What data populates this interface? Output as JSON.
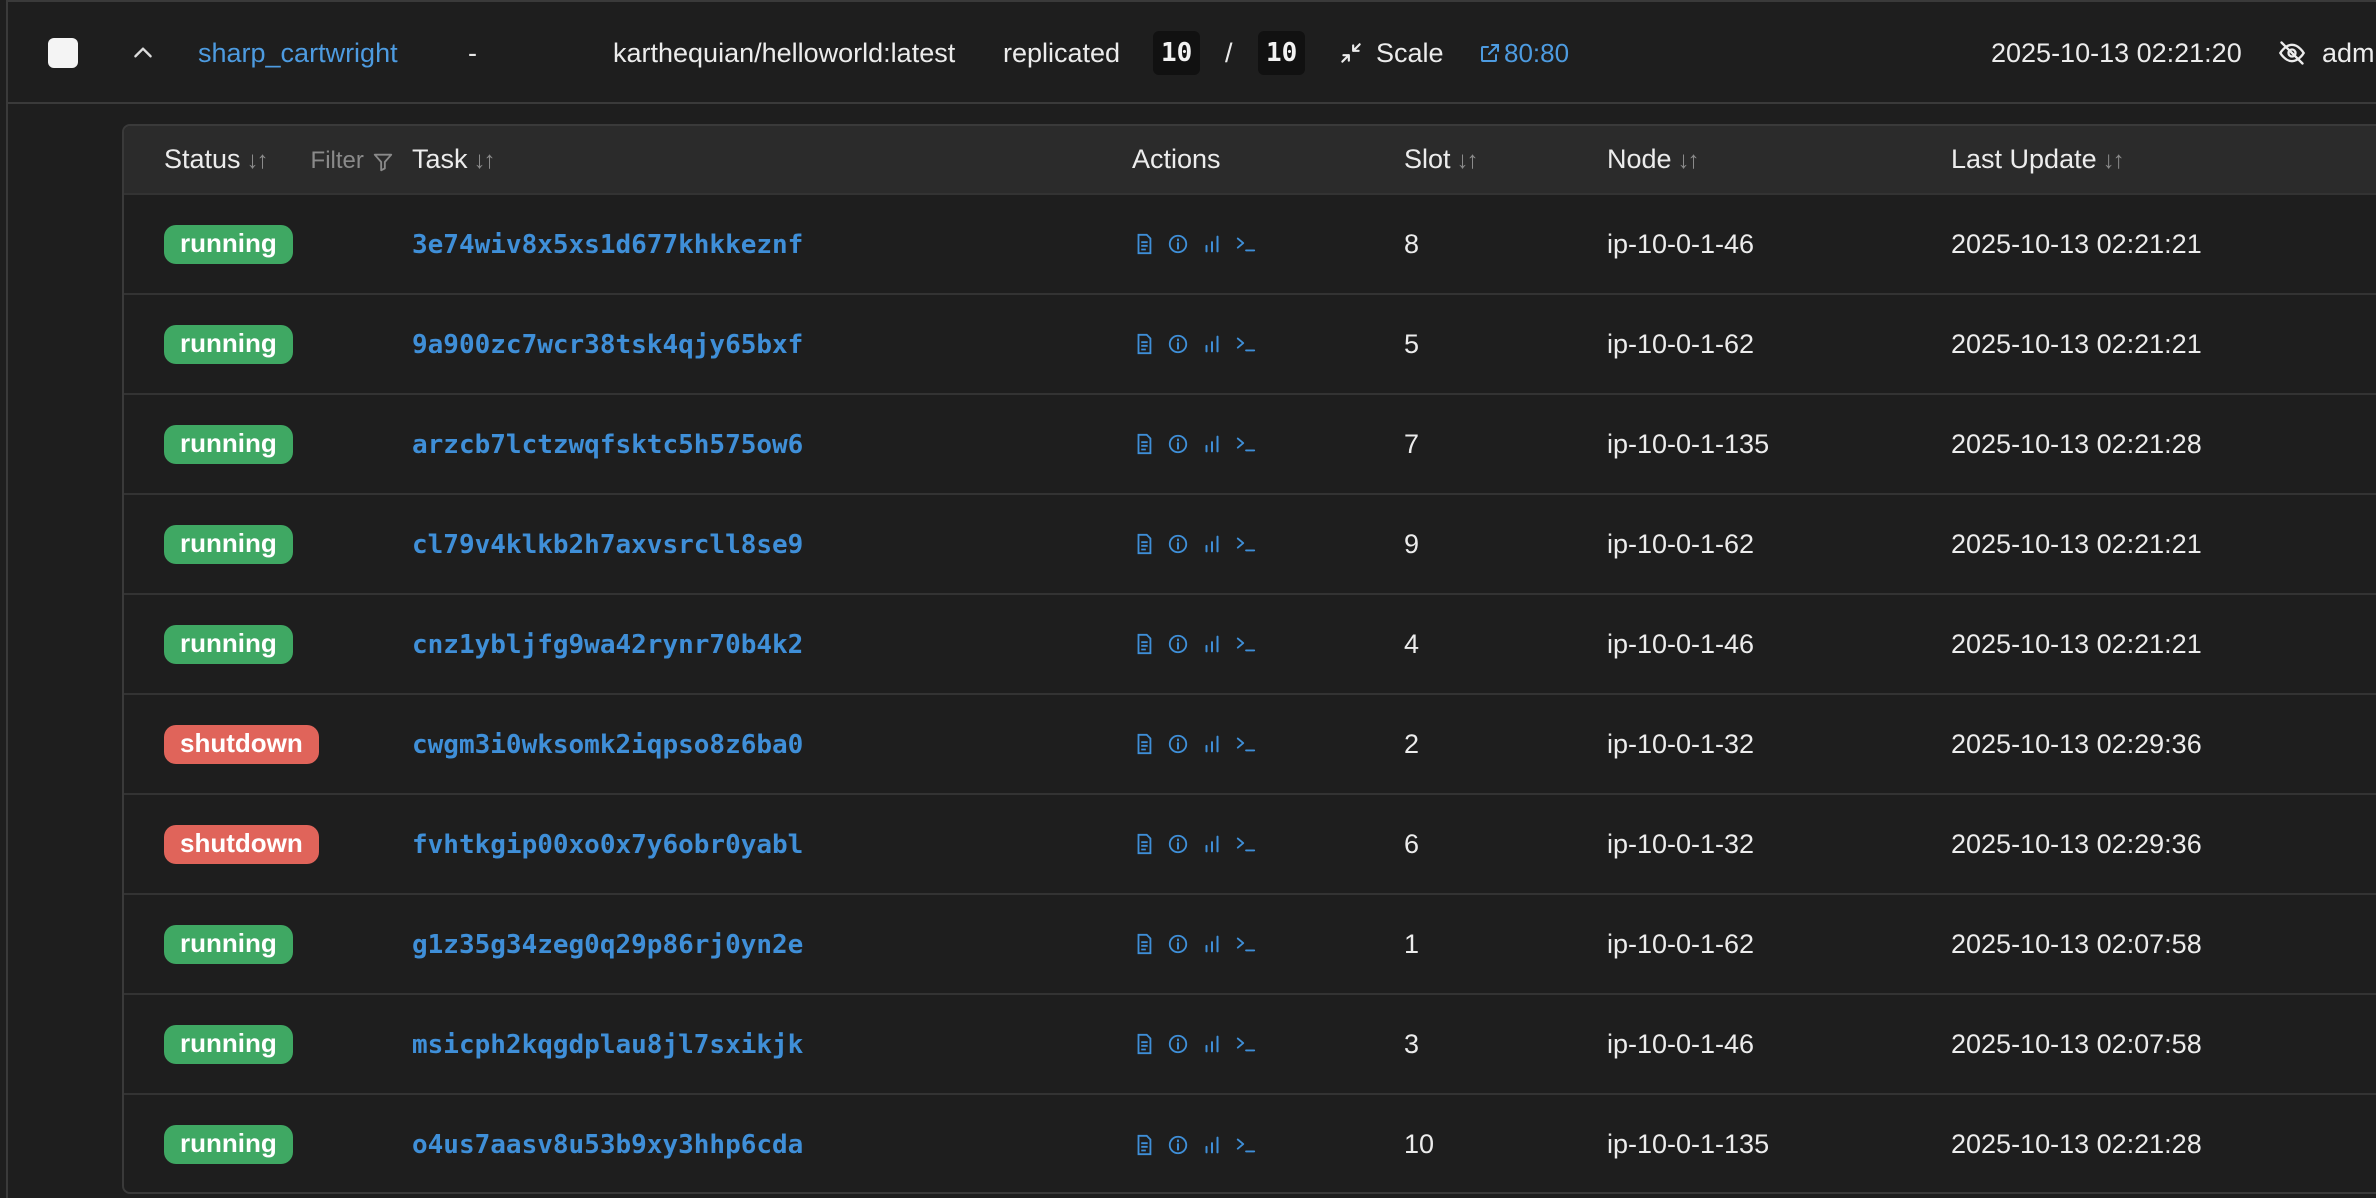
{
  "service": {
    "name": "sharp_cartwright",
    "dash": "-",
    "image": "karthequian/helloworld:latest",
    "mode": "replicated",
    "replicas_running": "10",
    "replicas_separator": "/",
    "replicas_desired": "10",
    "scale_label": "Scale",
    "port": "80:80",
    "updated": "2025-10-13 02:21:20",
    "user": "adm"
  },
  "table": {
    "headers": {
      "status": "Status",
      "filter": "Filter",
      "task": "Task",
      "actions": "Actions",
      "slot": "Slot",
      "node": "Node",
      "last_update": "Last Update"
    },
    "rows": [
      {
        "status": "running",
        "task": "3e74wiv8x5xs1d677khkkeznf",
        "slot": "8",
        "node": "ip-10-0-1-46",
        "last_update": "2025-10-13 02:21:21"
      },
      {
        "status": "running",
        "task": "9a900zc7wcr38tsk4qjy65bxf",
        "slot": "5",
        "node": "ip-10-0-1-62",
        "last_update": "2025-10-13 02:21:21"
      },
      {
        "status": "running",
        "task": "arzcb7lctzwqfsktc5h575ow6",
        "slot": "7",
        "node": "ip-10-0-1-135",
        "last_update": "2025-10-13 02:21:28"
      },
      {
        "status": "running",
        "task": "cl79v4klkb2h7axvsrcll8se9",
        "slot": "9",
        "node": "ip-10-0-1-62",
        "last_update": "2025-10-13 02:21:21"
      },
      {
        "status": "running",
        "task": "cnz1ybljfg9wa42rynr70b4k2",
        "slot": "4",
        "node": "ip-10-0-1-46",
        "last_update": "2025-10-13 02:21:21"
      },
      {
        "status": "shutdown",
        "task": "cwgm3i0wksomk2iqpso8z6ba0",
        "slot": "2",
        "node": "ip-10-0-1-32",
        "last_update": "2025-10-13 02:29:36"
      },
      {
        "status": "shutdown",
        "task": "fvhtkgip00xo0x7y6obr0yabl",
        "slot": "6",
        "node": "ip-10-0-1-32",
        "last_update": "2025-10-13 02:29:36"
      },
      {
        "status": "running",
        "task": "g1z35g34zeg0q29p86rj0yn2e",
        "slot": "1",
        "node": "ip-10-0-1-62",
        "last_update": "2025-10-13 02:07:58"
      },
      {
        "status": "running",
        "task": "msicph2kqgdplau8jl7sxikjk",
        "slot": "3",
        "node": "ip-10-0-1-46",
        "last_update": "2025-10-13 02:07:58"
      },
      {
        "status": "running",
        "task": "o4us7aasv8u53b9xy3hhp6cda",
        "slot": "10",
        "node": "ip-10-0-1-135",
        "last_update": "2025-10-13 02:21:28"
      }
    ]
  },
  "colors": {
    "running": "#3fa863",
    "shutdown": "#e0645a",
    "link": "#3f8fd8"
  },
  "icons": {
    "row_actions": [
      "logs-icon",
      "info-icon",
      "stats-icon",
      "terminal-icon"
    ]
  }
}
